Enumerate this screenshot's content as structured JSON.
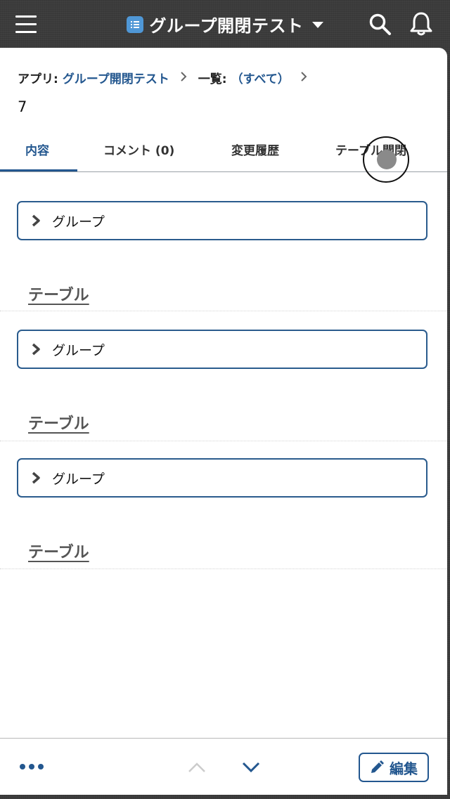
{
  "header": {
    "title": "グループ開閉テスト",
    "menu_icon": "hamburger-icon",
    "app_icon": "list-icon",
    "search_icon": "search-icon",
    "bell_icon": "bell-icon"
  },
  "breadcrumb": {
    "app_prefix": "アプリ:",
    "app_name": "グループ開閉テスト",
    "list_prefix": "一覧:",
    "list_name": "（すべて）"
  },
  "record": {
    "id": "7"
  },
  "tabs": [
    {
      "label": "内容",
      "active": true
    },
    {
      "label": "コメント (0)",
      "active": false
    },
    {
      "label": "変更履歴",
      "active": false
    },
    {
      "label": "テーブル開閉",
      "active": false
    }
  ],
  "sections": [
    {
      "group_label": "グループ",
      "table_label": "テーブル"
    },
    {
      "group_label": "グループ",
      "table_label": "テーブル"
    },
    {
      "group_label": "グループ",
      "table_label": "テーブル"
    }
  ],
  "bottombar": {
    "edit_label": "編集"
  },
  "colors": {
    "accent": "#23578f",
    "header_bg": "#3b3b3b",
    "app_icon": "#4f97d6"
  }
}
